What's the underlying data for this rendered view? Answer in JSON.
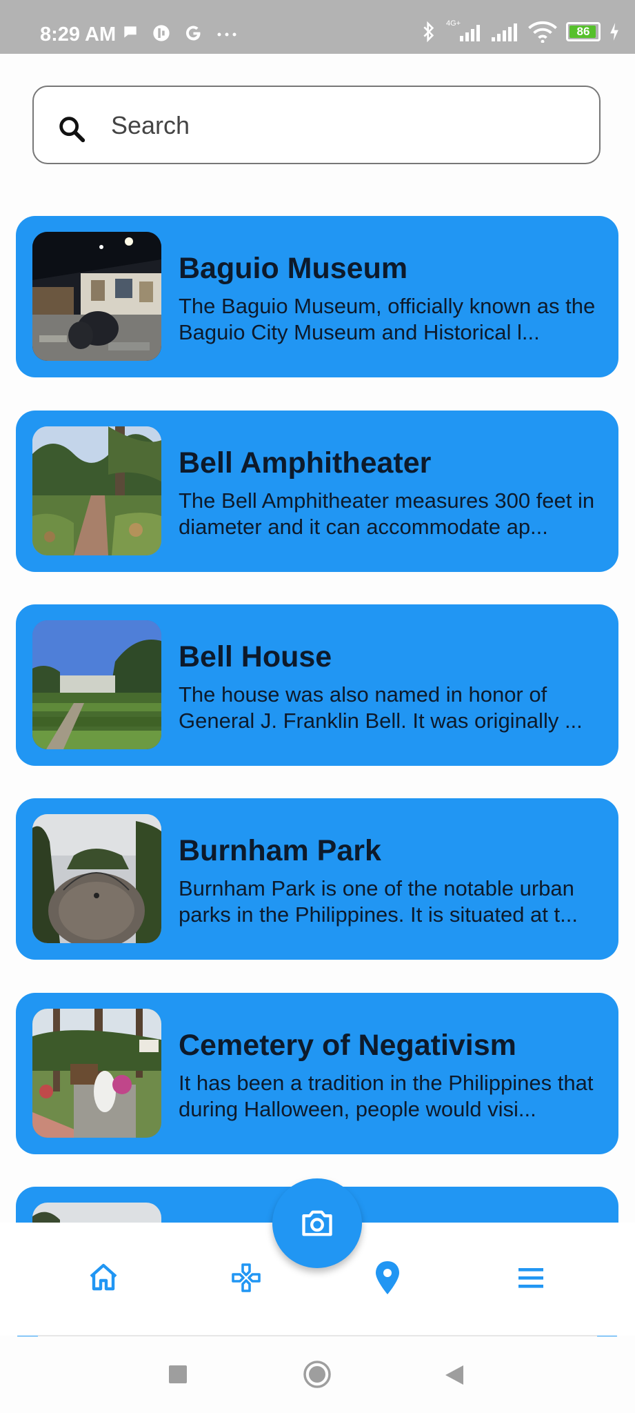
{
  "status_bar": {
    "time": "8:29 AM",
    "left_icons": [
      "chat-bubble-icon",
      "mute-icon",
      "google-icon",
      "more-dots-icon"
    ],
    "right_icons": [
      "bluetooth-icon",
      "signal-4g-icon",
      "signal-icon",
      "wifi-icon",
      "charging-icon"
    ],
    "network_label": "4G+",
    "battery_level": "86"
  },
  "search": {
    "placeholder": "Search",
    "value": ""
  },
  "places": [
    {
      "title": "Baguio Museum",
      "description": "The Baguio Museum, officially known as the Baguio City Museum and Historical l..."
    },
    {
      "title": "Bell Amphitheater",
      "description": "The Bell Amphitheater measures 300 feet in diameter and it can accommodate ap..."
    },
    {
      "title": "Bell House",
      "description": "The house was also named in honor of General J. Franklin Bell. It was originally ..."
    },
    {
      "title": "Burnham Park",
      "description": "Burnham Park is one of the notable urban parks in the Philippines. It is situated at t..."
    },
    {
      "title": "Cemetery of Negativism",
      "description": "It has been a tradition in the Philippines that during Halloween, people would visi..."
    }
  ],
  "bottom_nav": {
    "items": [
      "home-icon",
      "gamepad-icon",
      "location-pin-icon",
      "menu-icon"
    ],
    "fab_icon": "camera-icon"
  },
  "colors": {
    "accent": "#2196f3",
    "card_text": "#0d1a2b",
    "status_bar": "#b3b3b3"
  }
}
